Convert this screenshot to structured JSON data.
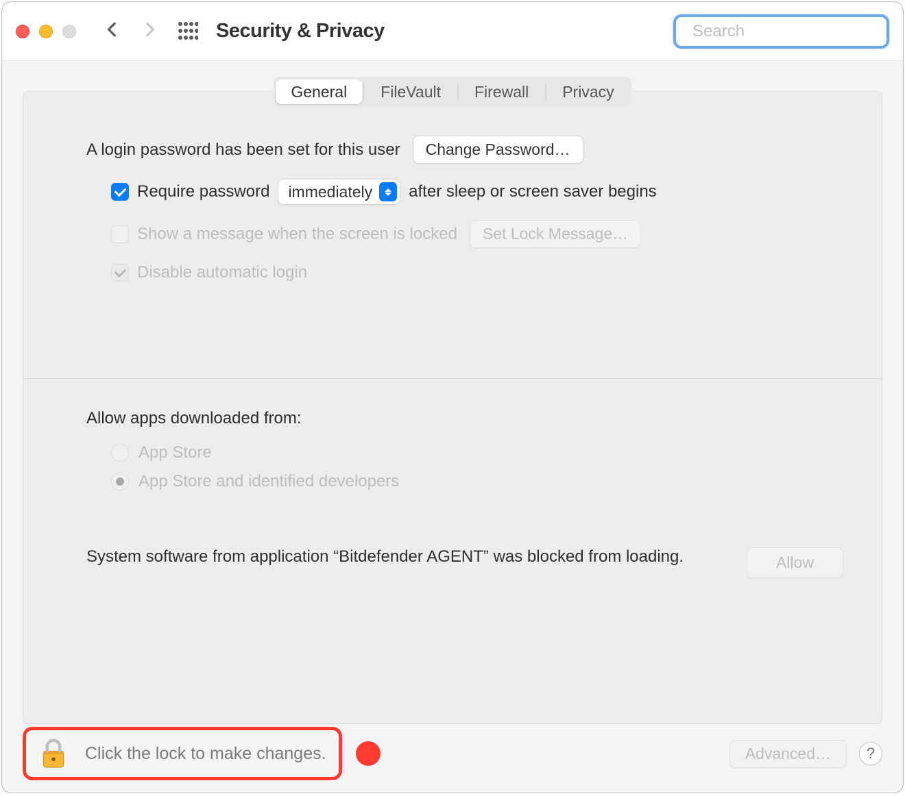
{
  "titlebar": {
    "title": "Security & Privacy",
    "search_placeholder": "Search"
  },
  "tabs": [
    {
      "label": "General",
      "active": true
    },
    {
      "label": "FileVault",
      "active": false
    },
    {
      "label": "Firewall",
      "active": false
    },
    {
      "label": "Privacy",
      "active": false
    }
  ],
  "general": {
    "login_password_text": "A login password has been set for this user",
    "change_password_label": "Change Password…",
    "require_password": {
      "checked": true,
      "prefix": "Require password",
      "delay": "immediately",
      "suffix": "after sleep or screen saver begins"
    },
    "show_message": {
      "checked": false,
      "disabled": true,
      "label": "Show a message when the screen is locked",
      "button_label": "Set Lock Message…"
    },
    "disable_auto_login": {
      "checked": true,
      "disabled": true,
      "label": "Disable automatic login"
    },
    "allow_apps_heading": "Allow apps downloaded from:",
    "allow_apps_options": [
      {
        "label": "App Store",
        "selected": false,
        "disabled": true
      },
      {
        "label": "App Store and identified developers",
        "selected": true,
        "disabled": true
      }
    ],
    "blocked_text": "System software from application “Bitdefender AGENT” was blocked from loading.",
    "allow_label": "Allow"
  },
  "footer": {
    "lock_text": "Click the lock to make changes.",
    "advanced_label": "Advanced…",
    "help": "?"
  }
}
